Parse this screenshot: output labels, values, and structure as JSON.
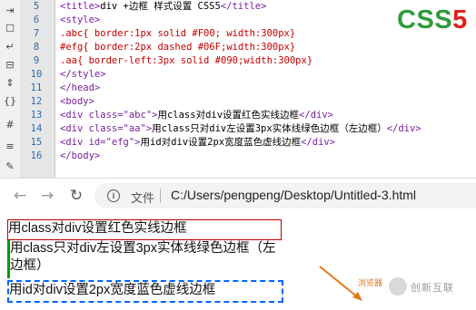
{
  "editor": {
    "line_numbers": [
      "5",
      "6",
      "7",
      "8",
      "9",
      "10",
      "11",
      "12",
      "13",
      "14",
      "15",
      "16"
    ],
    "lines": [
      [
        {
          "c": "tag",
          "t": "<title>"
        },
        {
          "c": "txt",
          "t": "div +边框 样式设置 CSS5"
        },
        {
          "c": "tag",
          "t": "</title>"
        }
      ],
      [
        {
          "c": "tag",
          "t": "<style>"
        }
      ],
      [
        {
          "c": "sel",
          "t": ".abc{ border:1px solid #F00; width:300px}"
        }
      ],
      [
        {
          "c": "sel",
          "t": "#efg{ border:2px dashed #06F;width:300px}"
        }
      ],
      [
        {
          "c": "sel",
          "t": ".aa{ border-left:3px solid #090;width:300px}"
        }
      ],
      [
        {
          "c": "tag",
          "t": "</style>"
        }
      ],
      [
        {
          "c": "tag",
          "t": "</head>"
        }
      ],
      [
        {
          "c": "tag",
          "t": "<body>"
        }
      ],
      [
        {
          "c": "tag",
          "t": "<div class=\"abc\">"
        },
        {
          "c": "txt",
          "t": "用class对div设置红色实线边框"
        },
        {
          "c": "tag",
          "t": "</div>"
        }
      ],
      [
        {
          "c": "tag",
          "t": "<div class=\"aa\">"
        },
        {
          "c": "txt",
          "t": "用class只对div左设置3px实体线绿色边框（左边框）"
        },
        {
          "c": "tag",
          "t": "</div>"
        }
      ],
      [
        {
          "c": "tag",
          "t": "<div id=\"efg\">"
        },
        {
          "c": "txt",
          "t": "用id对div设置2px宽度蓝色虚线边框"
        },
        {
          "c": "tag",
          "t": "</div>"
        }
      ],
      [
        {
          "c": "tag",
          "t": "</body>"
        }
      ]
    ],
    "badge_css": "CSS",
    "badge_num": "5"
  },
  "browser": {
    "file_label": "文件",
    "url": "C:/Users/pengpeng/Desktop/Untitled-3.html"
  },
  "page": {
    "abc_text": "用class对div设置红色实线边框",
    "aa_text": "用class只对div左设置3px实体线绿色边框（左边框）",
    "efg_text": "用id对div设置2px宽度蓝色虚线边框"
  },
  "annotation": {
    "label": "浏览器"
  },
  "watermark": {
    "text": "创新互联"
  },
  "colors": {
    "red_border": "#FF0000",
    "blue_dashed": "#0066FF",
    "green_left": "#009900",
    "arrow": "#E07A1A"
  }
}
